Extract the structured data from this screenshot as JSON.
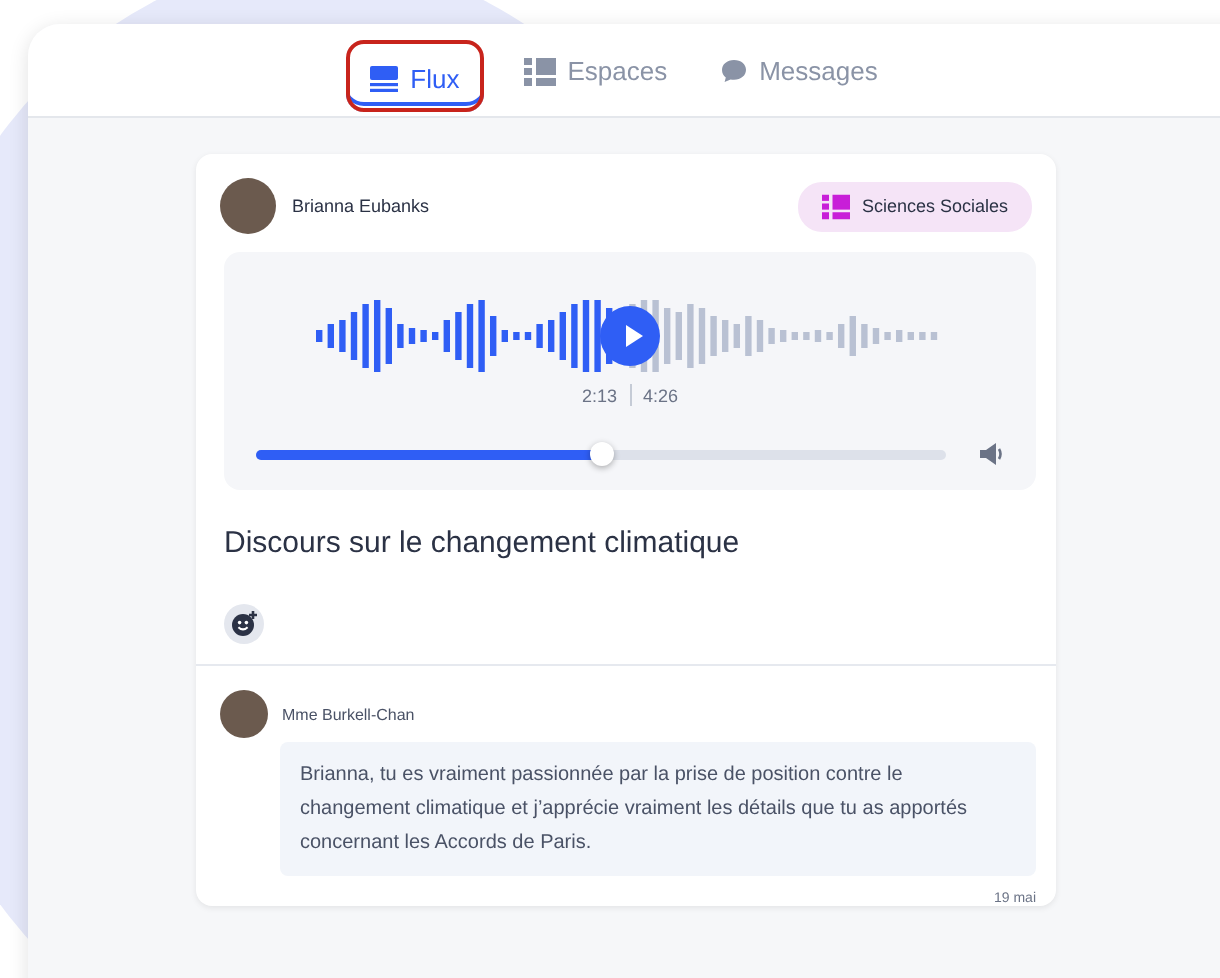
{
  "tabs": [
    {
      "label": "Flux",
      "selected": true,
      "kind": "feed",
      "highlighted": true
    },
    {
      "label": "Espaces",
      "selected": false,
      "kind": "spaces",
      "highlighted": false
    },
    {
      "label": "Messages",
      "selected": false,
      "kind": "chat",
      "highlighted": false
    }
  ],
  "post": {
    "author": "Brianna Eubanks",
    "space": "Sciences Sociales",
    "audio": {
      "current": "2:13",
      "duration": "4:26",
      "level": 0.5
    },
    "title": "Discours sur le changement climatique"
  },
  "comments": [
    {
      "author": "Mme Burkell-Chan",
      "text": "Brianna, tu es vraiment passionnée par la prise de position contre le changement climatique et j’apprécie vraiment les détails que tu as apportés concernant les Accords de Paris.",
      "date": "19 mai"
    }
  ]
}
